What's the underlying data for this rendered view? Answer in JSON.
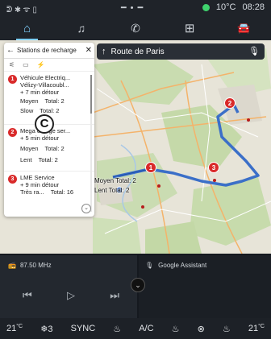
{
  "status": {
    "left_icons": "ᕲ ✱ ᯤ ▯",
    "mid": "━ • ━",
    "temperature": "10°C",
    "time": "08:28"
  },
  "nav": {
    "tabs": [
      {
        "name": "home",
        "glyph": "⌂"
      },
      {
        "name": "music",
        "glyph": "♫"
      },
      {
        "name": "phone",
        "glyph": "✆"
      },
      {
        "name": "apps",
        "glyph": "⊞"
      },
      {
        "name": "car",
        "glyph": "🚘"
      }
    ]
  },
  "search": {
    "arrow": "↑",
    "text": "Route de Paris",
    "mic": "🎙"
  },
  "panel": {
    "back": "←",
    "title": "Stations de recharge",
    "close": "✕",
    "filter_icons": [
      "⚟",
      "▭",
      "⚡"
    ],
    "stations": [
      {
        "num": "1",
        "name": "Véhicule Electriq...",
        "line2": "Vélizy-Villacoubl...",
        "line3": "+ 7 min détour",
        "a_label": "Moyen",
        "a_total": "Total: 2",
        "b_label": "Slow",
        "b_total": "Total: 2"
      },
      {
        "num": "2",
        "name": "Mega charge ser...",
        "line2": "+ 5 min détour",
        "line3": "",
        "a_label": "Moyen",
        "a_total": "Total: 2",
        "b_label": "Lent",
        "b_total": "Total: 2"
      },
      {
        "num": "3",
        "name": "LME Service",
        "line2": "+ 9 min détour",
        "line3": "",
        "a_label": "Très ra...",
        "a_total": "Total: 16",
        "b_label": "",
        "b_total": ""
      }
    ],
    "expand": "⌄"
  },
  "callout": "C",
  "map": {
    "labels": [
      {
        "id": "moyen",
        "text": "Moyen  Total: 2"
      },
      {
        "id": "lent",
        "text": "Lent    Total: 2"
      }
    ],
    "markers": [
      "1",
      "2",
      "3"
    ]
  },
  "media": {
    "radio_icon": "📻",
    "radio": "87.50 MHz",
    "prev": "⏮",
    "play": "▷",
    "next": "⏭"
  },
  "assistant": {
    "mic": "🎙",
    "label": "Google Assistant"
  },
  "collapse": "⌄",
  "climate": {
    "left_temp": "21",
    "unit": "°C",
    "fan": "❄3",
    "sync": "SYNC",
    "seat_heat": "♨",
    "ac": "A/C",
    "rear_defrost": "♨",
    "steering": "⊗",
    "seat_right": "♨",
    "right_temp": "21"
  }
}
